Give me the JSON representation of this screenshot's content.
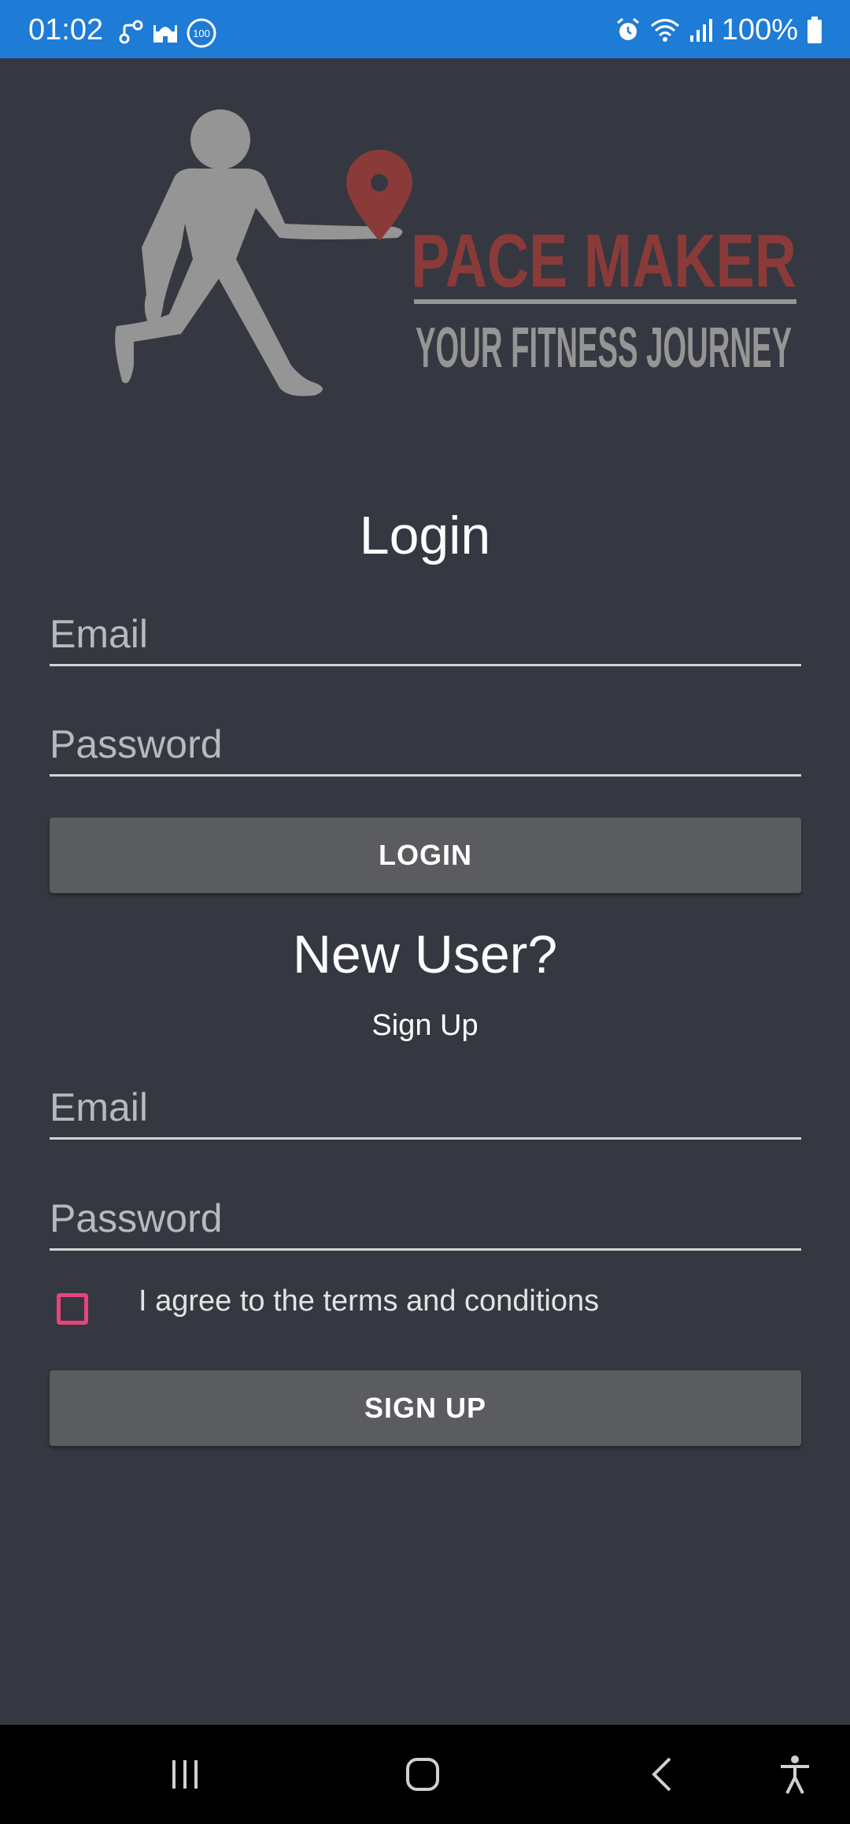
{
  "status_bar": {
    "time": "01:02",
    "battery_text": "100%",
    "left_icons": [
      "link-icon",
      "mosque-icon",
      "badge-100-icon"
    ],
    "right_icons": [
      "alarm-icon",
      "wifi-icon",
      "signal-icon",
      "battery-icon"
    ],
    "badge_text": "100"
  },
  "logo": {
    "brand": "PACE MAKER",
    "tagline": "YOUR FITNESS JOURNEY",
    "brand_color": "#8b3a3a",
    "figure_color": "#959595"
  },
  "login": {
    "title": "Login",
    "email_placeholder": "Email",
    "password_placeholder": "Password",
    "button_label": "LOGIN"
  },
  "signup": {
    "heading": "New User?",
    "link_text": "Sign Up",
    "email_placeholder": "Email",
    "password_placeholder": "Password",
    "terms_label": "I agree to the terms and conditions",
    "terms_checked": false,
    "button_label": "SIGN UP"
  },
  "nav_bar": {
    "icons": [
      "recent-apps-icon",
      "home-icon",
      "back-icon",
      "accessibility-icon"
    ]
  },
  "colors": {
    "status_bar": "#1e7bd6",
    "background": "#353840",
    "button": "#5b5c5f",
    "checkbox_accent": "#e8447a"
  }
}
